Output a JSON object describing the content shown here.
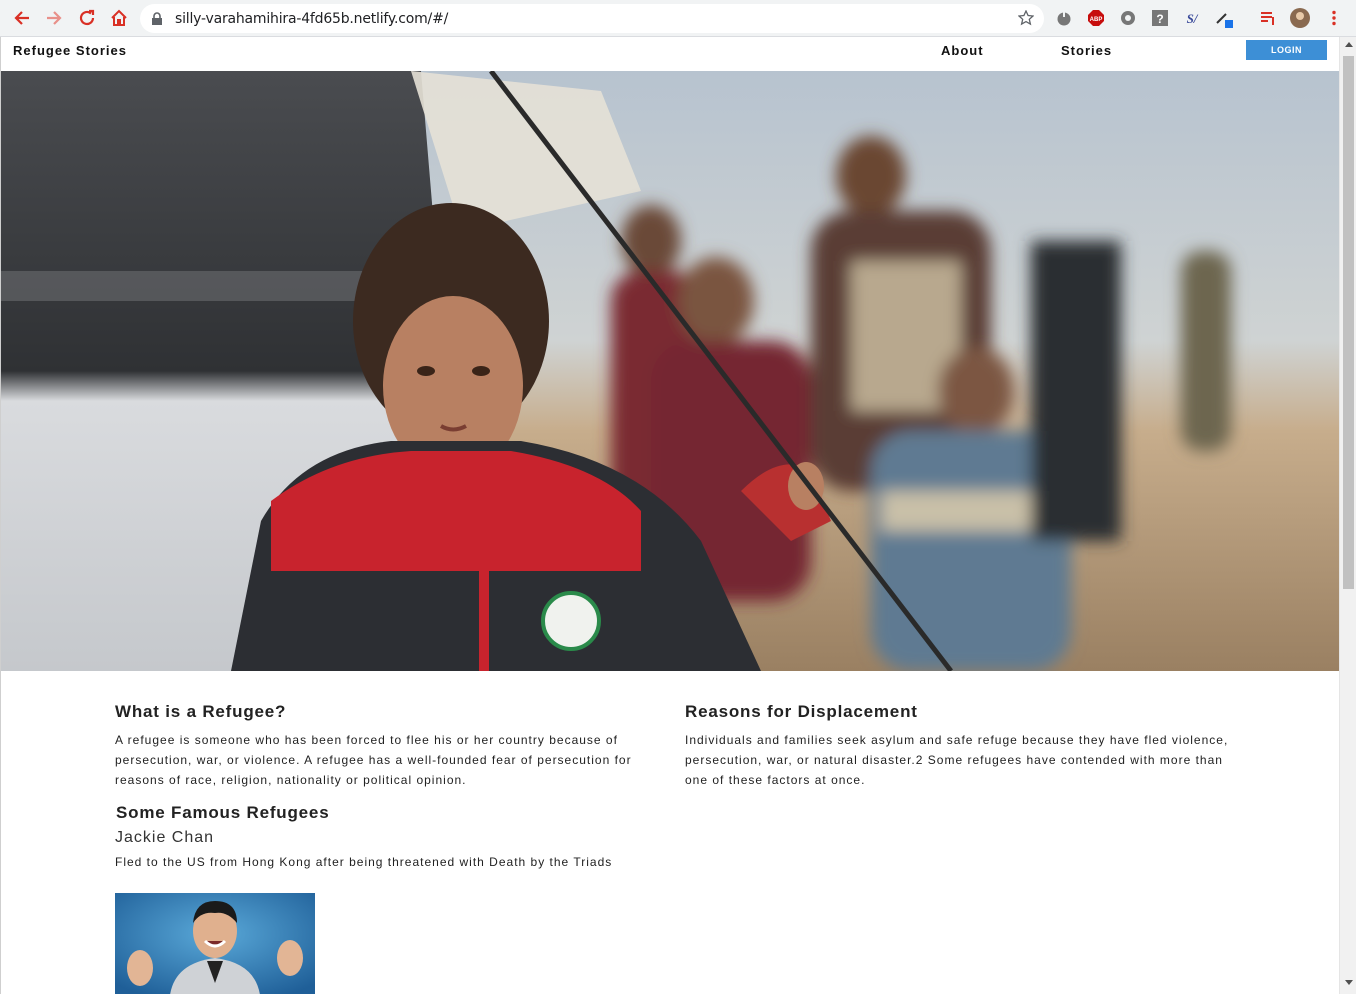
{
  "browser": {
    "url": "silly-varahamihira-4fd65b.netlify.com/#/",
    "extensions": [
      "abp-icon",
      "help-icon",
      "extension-icon",
      "menu-icon"
    ]
  },
  "site": {
    "brand": "Refugee Stories",
    "nav": {
      "about": "About",
      "stories": "Stories",
      "login": "LOGIN"
    }
  },
  "left_column": {
    "heading": "What is a Refugee?",
    "text": "A refugee is someone who has been forced to flee his or her country because of persecution, war, or violence. A refugee has a well-founded fear of persecution for reasons of race, religion, nationality or political opinion.",
    "famous_heading": "Some Famous Refugees",
    "person_name": "Jackie Chan",
    "person_text": "Fled to the US from Hong Kong after being threatened with Death by the Triads"
  },
  "right_column": {
    "heading": "Reasons for Displacement",
    "text": "Individuals and families seek asylum and safe refuge because they have fled violence, persecution, war, or natural disaster.2 Some refugees have contended with more than one of these factors at once."
  },
  "colors": {
    "accent": "#3d8fd6",
    "chrome_red": "#d93025"
  }
}
